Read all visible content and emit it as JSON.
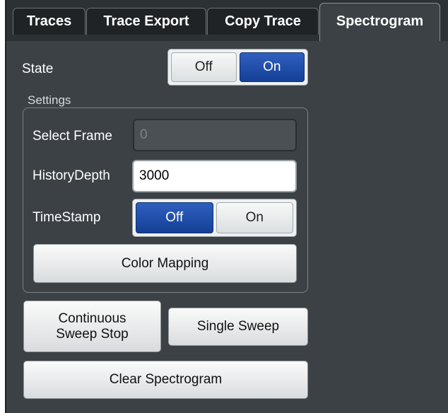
{
  "tabs": [
    {
      "label": "Traces",
      "active": false
    },
    {
      "label": "Trace Export",
      "active": false
    },
    {
      "label": "Copy Trace",
      "active": false
    },
    {
      "label": "Spectrogram",
      "active": true
    }
  ],
  "state": {
    "label": "State",
    "off": "Off",
    "on": "On",
    "value": "On"
  },
  "settings": {
    "group_label": "Settings",
    "select_frame": {
      "label": "Select Frame",
      "value": "0"
    },
    "history_depth": {
      "label": "HistoryDepth",
      "value": "3000"
    },
    "timestamp": {
      "label": "TimeStamp",
      "off": "Off",
      "on": "On",
      "value": "Off"
    },
    "color_mapping": "Color Mapping"
  },
  "buttons": {
    "continuous_line1": "Continuous",
    "continuous_line2": "Sweep Stop",
    "single_sweep": "Single Sweep",
    "clear_spectrogram": "Clear Spectrogram"
  },
  "colors": {
    "active_blue": "#1f4aa8",
    "panel_bg": "#3b4145"
  }
}
